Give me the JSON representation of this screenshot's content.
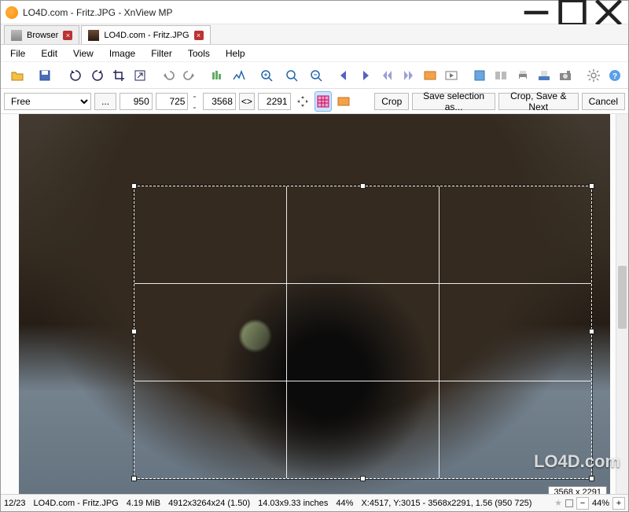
{
  "title": "LO4D.com - Fritz.JPG - XnView MP",
  "tabs": {
    "browser": "Browser",
    "image": "LO4D.com - Fritz.JPG"
  },
  "menu": {
    "file": "File",
    "edit": "Edit",
    "view": "View",
    "image": "Image",
    "filter": "Filter",
    "tools": "Tools",
    "help": "Help"
  },
  "cropbar": {
    "ratio": "Free",
    "dots_btn": "...",
    "width": "950",
    "height": "725",
    "sep1": "--",
    "selw": "3568",
    "sep2": "<>",
    "selh": "2291",
    "crop": "Crop",
    "save_sel": "Save selection as...",
    "crop_next": "Crop, Save & Next",
    "cancel": "Cancel"
  },
  "selection": {
    "label": "3568 x 2291"
  },
  "status": {
    "index": "12/23",
    "filename": "LO4D.com - Fritz.JPG",
    "size": "4.19 MiB",
    "dims": "4912x3264x24 (1.50)",
    "inches": "14.03x9.33 inches",
    "zoom": "44%",
    "coords": "X:4517, Y:3015 - 3568x2291, 1.56 (950 725)",
    "zoom2": "44%"
  },
  "watermark": "LO4D.com"
}
